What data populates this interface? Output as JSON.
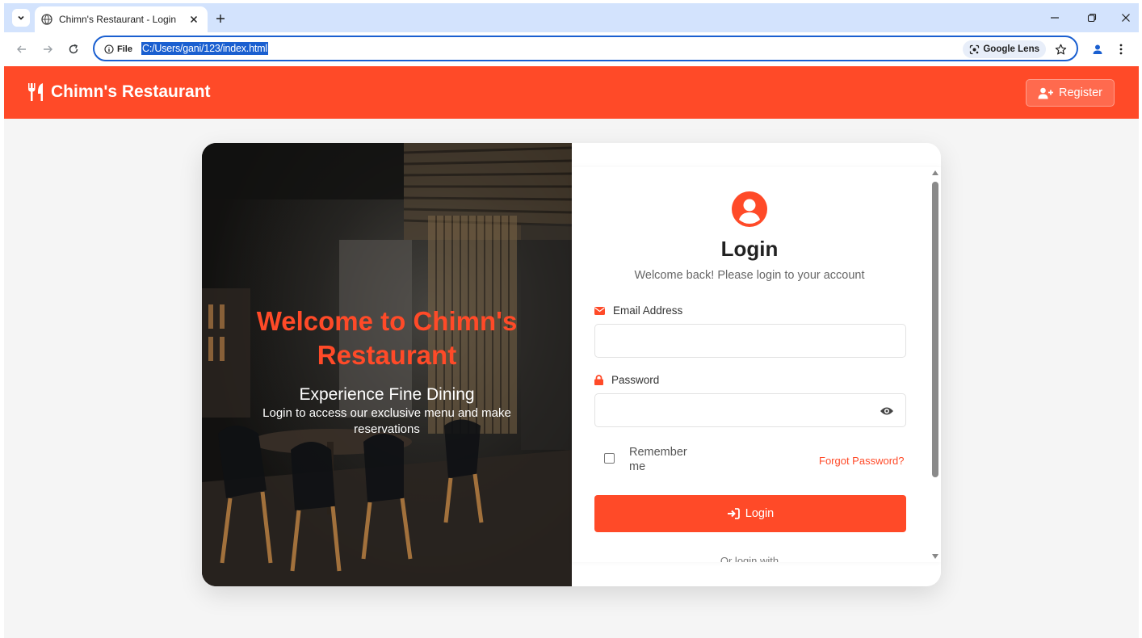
{
  "browser": {
    "tab_title": "Chimn's Restaurant - Login",
    "site_info_label": "File",
    "url": "C:/Users/gani/123/index.html",
    "lens_label": "Google Lens"
  },
  "header": {
    "brand": "Chimn's Restaurant",
    "register_label": "Register"
  },
  "hero": {
    "title": "Welcome to Chimn's Restaurant",
    "subtitle": "Experience Fine Dining",
    "description": "Login to access our exclusive menu and make reservations"
  },
  "login": {
    "title": "Login",
    "subtitle": "Welcome back! Please login to your account",
    "email_label": "Email Address",
    "email_value": "",
    "password_label": "Password",
    "password_value": "",
    "remember_label": "Remember me",
    "remember_checked": false,
    "forgot_label": "Forgot Password?",
    "submit_label": "Login",
    "alt_login_label": "Or login with"
  },
  "colors": {
    "brand": "#ff4a28",
    "tabstrip": "#d3e3fd",
    "omnibox_focus": "#1a5fd0"
  }
}
